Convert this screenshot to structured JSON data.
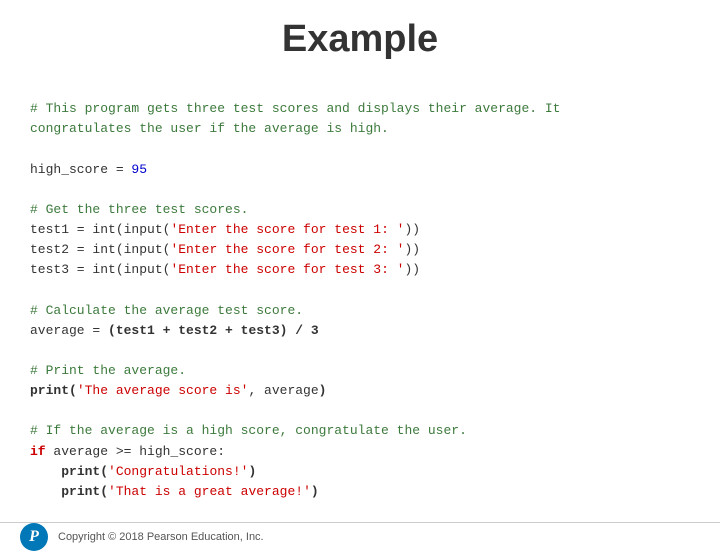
{
  "title": "Example",
  "code": {
    "comment1": "# This program gets three test scores and displays their average. It\ncongratulates the user if the average is high.",
    "blank1": "",
    "line_high_score": "high_score = 95",
    "blank2": "",
    "comment2": "# Get the three test scores.",
    "line_test1": "test1 = int(input('Enter the score for test 1: '))",
    "line_test2": "test2 = int(input('Enter the score for test 2: '))",
    "line_test3": "test3 = int(input('Enter the score for test 3: '))",
    "blank3": "",
    "comment3": "# Calculate the average test score.",
    "line_average": "average = (test1 + test2 + test3) / 3",
    "blank4": "",
    "comment4": "# Print the average.",
    "line_print": "print('The average score is', average)",
    "blank5": "",
    "comment5": "# If the average is a high score, congratulate the user.",
    "line_if": "if average >= high_score:",
    "line_print2": "    print('Congratulations!')",
    "line_print3": "    print('That is a great average!')"
  },
  "footer": {
    "copyright": "Copyright © 2018 Pearson Education, Inc.",
    "logo_letter": "P"
  }
}
